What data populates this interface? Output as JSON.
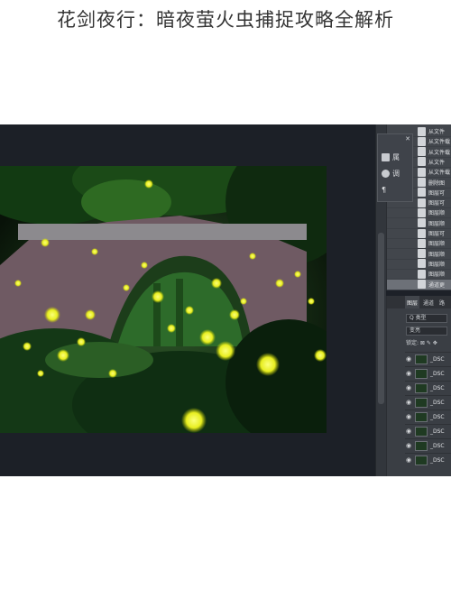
{
  "page": {
    "title": "花剑夜行：暗夜萤火虫捕捉攻略全解析"
  },
  "properties_popup": {
    "close_label": "✕",
    "tools": [
      {
        "icon": "image-icon",
        "label": "属"
      },
      {
        "icon": "adjust-icon",
        "label": "调"
      },
      {
        "icon": "paragraph-icon",
        "label": "¶"
      }
    ]
  },
  "history_panel": {
    "items": [
      {
        "label": "从文件"
      },
      {
        "label": "从文件载"
      },
      {
        "label": "从文件载"
      },
      {
        "label": "从文件"
      },
      {
        "label": "从文件载"
      },
      {
        "label": "删除图"
      },
      {
        "label": "图层可"
      },
      {
        "label": "图层可"
      },
      {
        "label": "图层顺"
      },
      {
        "label": "图层顺"
      },
      {
        "label": "图层可"
      },
      {
        "label": "图层顺"
      },
      {
        "label": "图层顺"
      },
      {
        "label": "图层顺"
      },
      {
        "label": "图层顺"
      },
      {
        "label": "通道更"
      }
    ],
    "selected_index": 15
  },
  "layers_panel": {
    "tabs": [
      "图层",
      "通道",
      "路"
    ],
    "active_tab": 0,
    "filter_label": "Q 类型",
    "blend_mode": "变亮",
    "lock_label": "锁定: ⊠ ✎ ✥",
    "layers": [
      {
        "name": "_DSC"
      },
      {
        "name": "_DSC"
      },
      {
        "name": "_DSC"
      },
      {
        "name": "_DSC"
      },
      {
        "name": "_DSC"
      },
      {
        "name": "_DSC"
      },
      {
        "name": "_DSC"
      },
      {
        "name": "_DSC"
      }
    ]
  },
  "photo": {
    "subject": "stone arch bridge with fireflies at night"
  },
  "colors": {
    "app_background": "#1d2128",
    "panel": "#42464c",
    "firefly": "#f4f23a"
  }
}
